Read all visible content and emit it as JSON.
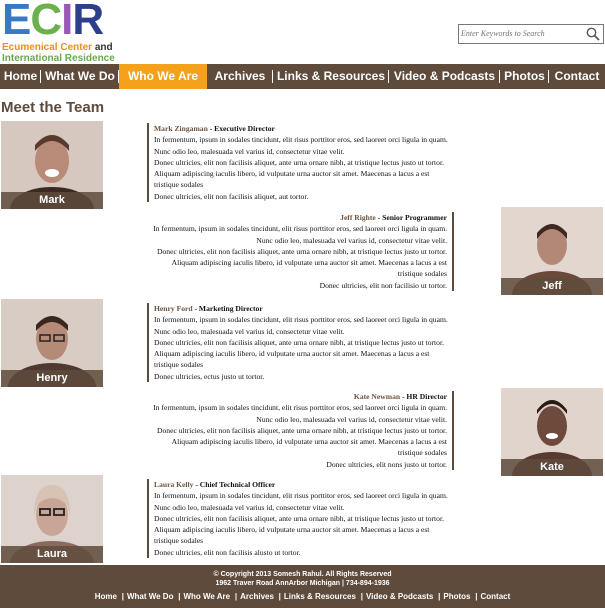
{
  "logo": {
    "letters": [
      "E",
      "C",
      "I",
      "R"
    ],
    "line1a": "Ecumenical Center ",
    "line1b": "and",
    "line2": "International Residence"
  },
  "search": {
    "placeholder": "Enter Keywords to Search"
  },
  "nav": [
    "Home",
    "What We Do",
    "Who We Are",
    "Archives",
    "Links & Resources",
    "Video & Podcasts",
    "Photos",
    "Contact"
  ],
  "nav_active": "Who We Are",
  "page_title": "Meet the Team",
  "team": [
    {
      "name": "Mark",
      "person": "Mark Zingaman",
      "role": " - Executive Director",
      "lines": [
        "In fermentum, ipsum in sodales tincidunt, elit risus porttitor eros, sed laoreet orci ligula in quam. Nunc odio leo, malesuada vel varius id, consectetur vitae velit.",
        "Donec ultricies, elit non facilisis aliquet, ante urna ornare nibh, at tristique lectus justo ut tortor. Aliquam adipiscing iaculis libero, id vulputate urna auctor sit amet. Maecenas a lacus a est tristique sodales",
        "Donec ultricies, elit non facilisis aliquet, aut tortor."
      ]
    },
    {
      "name": "Jeff",
      "person": "Jeff Righte",
      "role": " - Senior Programmer",
      "lines": [
        "In fermentum, ipsum in sodales tincidunt, elit risus porttitor eros, sed laoreet orci ligula in quam. Nunc odio leo, malesuada vel varius id, consectetur vitae velit.",
        "Donec ultricies, elit non facilisis aliquet, ante urna ornare nibh, at tristique lectus justo ut tortor. Aliquam adipiscing iaculis libero, id vulputate urna auctor sit amet. Maecenas a lacus a est tristique sodales",
        "Donec ultricies, elit non facilisio ut tortor."
      ]
    },
    {
      "name": "Henry",
      "person": "Henry Ford",
      "role": " - Marketing Director",
      "lines": [
        "In fermentum, ipsum in sodales tincidunt, elit risus porttitor eros, sed laoreet orci ligula in quam. Nunc odio leo, malesuada vel varius id, consectetur vitae velit.",
        "Donec ultricies, elit non facilisis aliquet, ante urna ornare nibh, at tristique lectus justo ut tortor. Aliquam adipiscing iaculis libero, id vulputate urna auctor sit amet. Maecenas a lacus a est tristique sodales",
        "Donec ultricies, ectus justo ut tortor."
      ]
    },
    {
      "name": "Kate",
      "person": "Kate Newman",
      "role": " - HR Director",
      "lines": [
        "In fermentum, ipsum in sodales tincidunt, elit risus porttitor eros, sed laoreet orci ligula in quam. Nunc odio leo, malesuada vel varius id, consectetur vitae velit.",
        "Donec ultricies, elit non facilisis aliquet, ante urna ornare nibh, at tristique lectus justo ut tortor. Aliquam adipiscing iaculis libero, id vulputate urna auctor sit amet. Maecenas a lacus a est tristique sodales",
        "Donec ultricies, elit nons justo ut tortor."
      ]
    },
    {
      "name": "Laura",
      "person": "Laura Kelly",
      "role": " - Chief Technical Officer",
      "lines": [
        "In fermentum, ipsum in sodales tincidunt, elit risus porttitor eros, sed laoreet orci ligula in quam. Nunc odio leo, malesuada vel varius id, consectetur vitae velit.",
        "Donec ultricies, elit non facilisis aliquet, ante urna ornare nibh, at tristique lectus justo ut tortor. Aliquam adipiscing iaculis libero, id vulputate urna auctor sit amet. Maecenas a lacus a est tristique sodales",
        "Donec ultricies, elit non facilisis alusto ut tortor."
      ]
    }
  ],
  "footer": {
    "copyright": "© Copyright 2013 Somesh Rahul. All Rights Reserved",
    "address": "1962 Traver Road AnnArbor Michigan | 734-894-1936",
    "links": [
      "Home",
      "What We Do",
      "Who We Are",
      "Archives",
      "Links & Resources",
      "Video & Podcasts",
      "Photos",
      "Contact"
    ]
  },
  "colors": {
    "brand_brown": "#5e4b3c",
    "active_orange": "#f4a21b"
  }
}
